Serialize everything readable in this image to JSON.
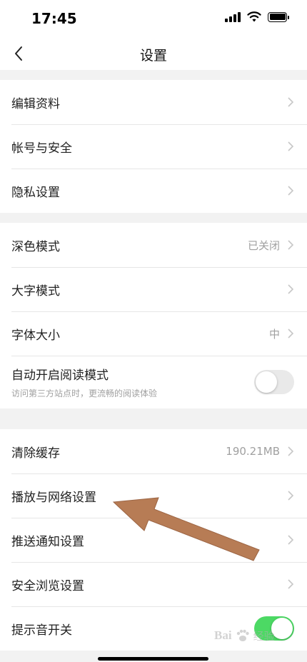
{
  "status_bar": {
    "time": "17:45"
  },
  "nav": {
    "title": "设置"
  },
  "groups": [
    {
      "items": [
        {
          "label": "编辑资料"
        },
        {
          "label": "帐号与安全"
        },
        {
          "label": "隐私设置"
        }
      ]
    },
    {
      "items": [
        {
          "label": "深色模式",
          "value": "已关闭"
        },
        {
          "label": "大字模式"
        },
        {
          "label": "字体大小",
          "value": "中"
        },
        {
          "label": "自动开启阅读模式",
          "sublabel": "访问第三方站点时，更流畅的阅读体验",
          "toggle": "off"
        }
      ]
    },
    {
      "items": [
        {
          "label": "清除缓存",
          "value": "190.21MB"
        },
        {
          "label": "播放与网络设置"
        },
        {
          "label": "推送通知设置"
        },
        {
          "label": "安全浏览设置"
        },
        {
          "label": "提示音开关",
          "toggle": "on"
        }
      ]
    }
  ],
  "watermark": {
    "text": "Bai",
    "sub": "经验"
  },
  "colors": {
    "toggle_on": "#4cd964",
    "arrow": "#b77c55",
    "background": "#f2f2f2"
  },
  "icons": [
    "back-chevron-icon",
    "chevron-right-icon",
    "signal-icon",
    "wifi-icon",
    "battery-icon",
    "paw-icon"
  ]
}
